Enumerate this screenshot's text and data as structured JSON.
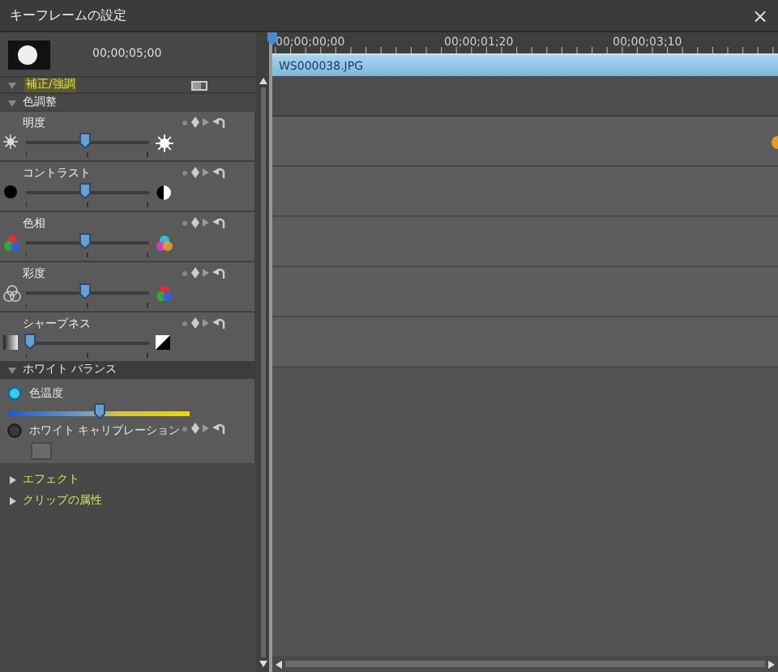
{
  "window": {
    "title": "キーフレームの設定",
    "close": "×"
  },
  "preview": {
    "time": "00;00;05;00"
  },
  "timeline": {
    "ticks": [
      "00;00;00;00",
      "00;00;01;20",
      "00;00;03;10"
    ],
    "clip": "WS000038.JPG"
  },
  "group": {
    "label": "補正/強調",
    "expanded": true
  },
  "color_adjust": {
    "label": "色調整",
    "expanded": true,
    "sliders": [
      {
        "name": "明度",
        "kind": "brightness",
        "level": 0.48
      },
      {
        "name": "コントラスト",
        "kind": "contrast",
        "level": 0.48
      },
      {
        "name": "色相",
        "kind": "hue",
        "level": 0.48
      },
      {
        "name": "彩度",
        "kind": "saturation",
        "level": 0.48
      },
      {
        "name": "シャープネス",
        "kind": "sharpness",
        "level": 0.02
      }
    ]
  },
  "white_balance": {
    "label": "ホワイト バランス",
    "expanded": true,
    "options": [
      {
        "label": "色温度",
        "selected": true,
        "level": 0.5
      },
      {
        "label": "ホワイト キャリブレーション",
        "selected": false
      }
    ]
  },
  "collapsed": [
    {
      "label": "エフェクト",
      "expanded": false
    },
    {
      "label": "クリップの属性",
      "expanded": false
    }
  ]
}
